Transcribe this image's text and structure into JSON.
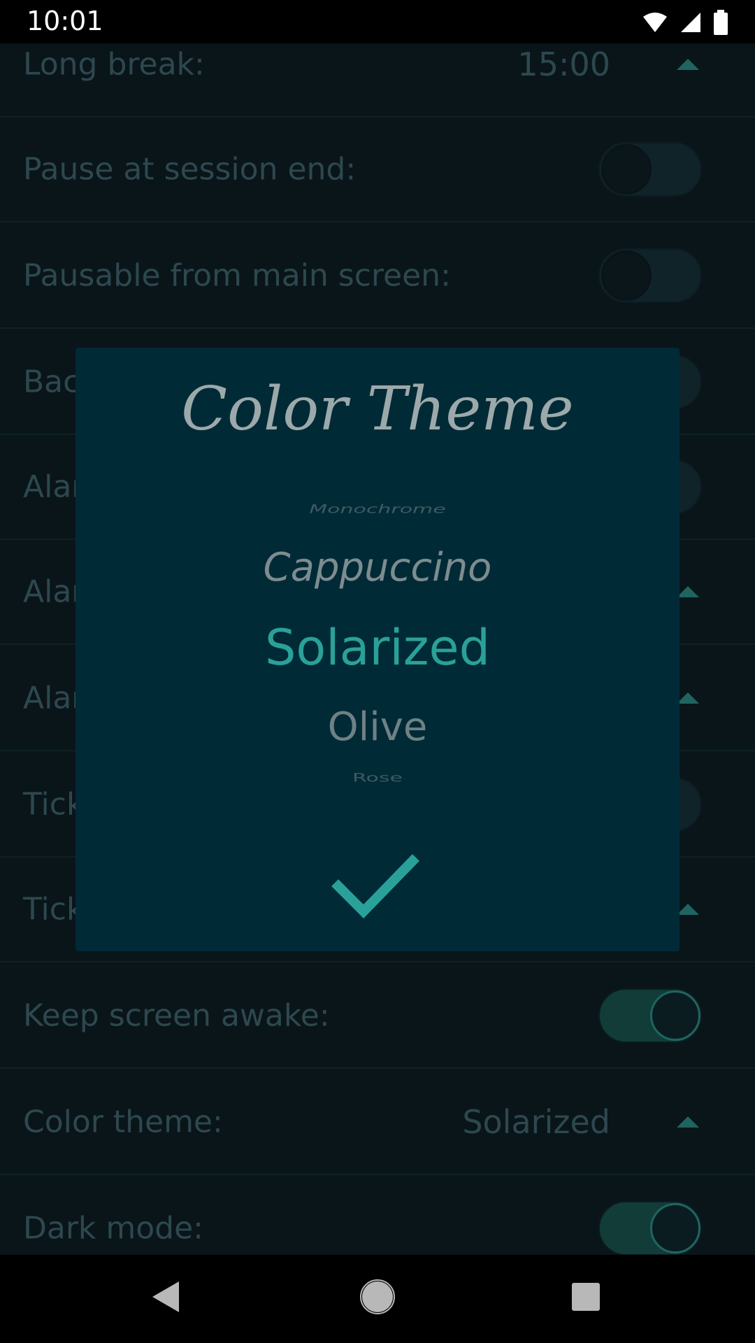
{
  "status_bar": {
    "time": "10:01"
  },
  "settings": {
    "rows": [
      {
        "label": "Long break:",
        "value": "15:00"
      },
      {
        "label": "Pause at session end:"
      },
      {
        "label": "Pausable from main screen:"
      },
      {
        "label": "Bac"
      },
      {
        "label": "Alar"
      },
      {
        "label": "Alar"
      },
      {
        "label": "Alar"
      },
      {
        "label": "Tick"
      },
      {
        "label": "Tick"
      },
      {
        "label": "Keep screen awake:"
      },
      {
        "label": "Color theme:",
        "value": "Solarized"
      },
      {
        "label": "Dark mode:"
      }
    ]
  },
  "dialog": {
    "title": "Color Theme",
    "options": [
      "Monochrome",
      "Cappuccino",
      "Solarized",
      "Olive",
      "Rose"
    ],
    "selected": "Solarized",
    "confirm_icon": "checkmark-icon"
  },
  "colors": {
    "accent": "#2aa198",
    "dialog_bg": "#012a37"
  },
  "nav_bar": {
    "icons": [
      "back-icon",
      "home-icon",
      "recents-icon"
    ]
  }
}
